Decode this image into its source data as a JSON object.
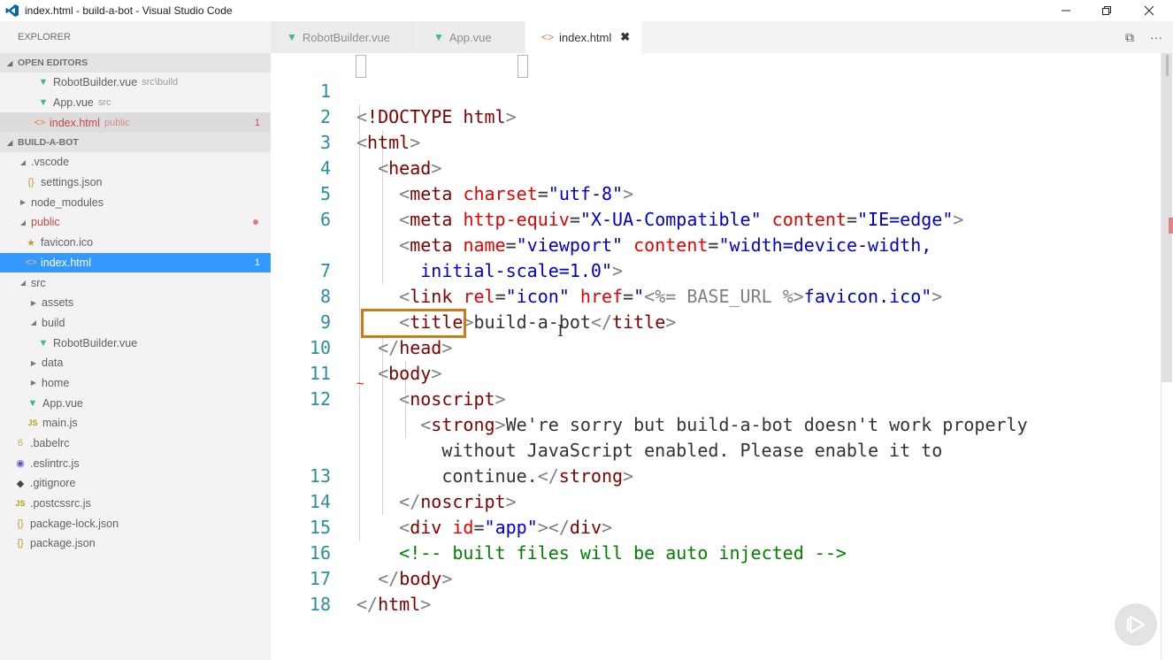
{
  "window": {
    "title": "index.html - build-a-bot - Visual Studio Code"
  },
  "sidebar": {
    "header": "EXPLORER",
    "open_editors": {
      "label": "OPEN EDITORS",
      "items": [
        {
          "name": "RobotBuilder.vue",
          "hint": "src\\build"
        },
        {
          "name": "App.vue",
          "hint": "src"
        },
        {
          "name": "index.html",
          "hint": "public",
          "count": "1"
        }
      ]
    },
    "project": {
      "label": "BUILD-A-BOT",
      "items": [
        {
          "name": ".vscode"
        },
        {
          "name": "settings.json"
        },
        {
          "name": "node_modules"
        },
        {
          "name": "public"
        },
        {
          "name": "favicon.ico"
        },
        {
          "name": "index.html",
          "count": "1"
        },
        {
          "name": "src"
        },
        {
          "name": "assets"
        },
        {
          "name": "build"
        },
        {
          "name": "RobotBuilder.vue"
        },
        {
          "name": "data"
        },
        {
          "name": "home"
        },
        {
          "name": "App.vue"
        },
        {
          "name": "main.js"
        },
        {
          "name": ".babelrc"
        },
        {
          "name": ".eslintrc.js"
        },
        {
          "name": ".gitignore"
        },
        {
          "name": ".postcssrc.js"
        },
        {
          "name": "package-lock.json"
        },
        {
          "name": "package.json"
        }
      ]
    }
  },
  "tabs": [
    {
      "label": "RobotBuilder.vue"
    },
    {
      "label": "App.vue"
    },
    {
      "label": "index.html",
      "close": "✖"
    }
  ],
  "tab_actions": {
    "split": "⧉",
    "more": "···"
  },
  "editor": {
    "lines": [
      {
        "n": "1"
      },
      {
        "n": "2"
      },
      {
        "n": "3"
      },
      {
        "n": "4"
      },
      {
        "n": "5"
      },
      {
        "n": "6"
      },
      {
        "n": ""
      },
      {
        "n": "7"
      },
      {
        "n": "8"
      },
      {
        "n": "9"
      },
      {
        "n": "10"
      },
      {
        "n": "11"
      },
      {
        "n": "12"
      },
      {
        "n": ""
      },
      {
        "n": ""
      },
      {
        "n": "13"
      },
      {
        "n": "14"
      },
      {
        "n": "15"
      },
      {
        "n": "16"
      },
      {
        "n": "17"
      },
      {
        "n": "18"
      }
    ],
    "code": {
      "doctype": "!DOCTYPE html",
      "html_open": "html",
      "head_open": "head",
      "meta": "meta",
      "charset_attr": "charset",
      "charset_val": "\"utf-8\"",
      "http_equiv_attr": "http-equiv",
      "http_equiv_val": "\"X-UA-Compatible\"",
      "content_attr": "content",
      "content_val": "\"IE=edge\"",
      "name_attr": "name",
      "name_val": "\"viewport\"",
      "viewport_val_1": "\"width=device-width,",
      "viewport_val_2": "initial-scale=1.0\"",
      "link": "link",
      "rel_attr": "rel",
      "rel_val": "\"icon\"",
      "href_attr": "href",
      "href_val_1": "\"",
      "href_tpl": "<%= BASE_URL %>",
      "href_val_2": "favicon.ico\"",
      "title_tag": "title",
      "title_text": "build-a-bot",
      "body": "body",
      "noscript": "noscript",
      "strong": "strong",
      "strong_text_1": "We're sorry but build-a-bot doesn't work properly",
      "strong_text_2": "without JavaScript enabled. Please enable it to",
      "strong_text_3": "continue.",
      "div": "div",
      "id_attr": "id",
      "id_val": "\"app\"",
      "comment": "<!-- built files will be auto injected -->"
    }
  },
  "icons": {
    "vue": "vue-icon",
    "html": "html-icon",
    "json": "json-icon",
    "js": "js-icon",
    "favicon": "star-icon"
  }
}
